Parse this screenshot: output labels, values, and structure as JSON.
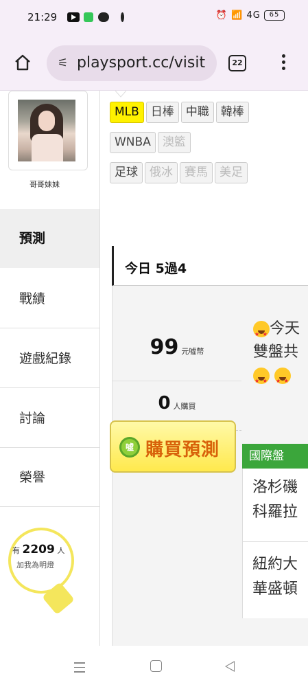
{
  "status_bar": {
    "time": "21:29",
    "network": "4G",
    "battery": "65"
  },
  "browser": {
    "url": "playsport.cc/visit",
    "tab_count": "22"
  },
  "sidebar": {
    "username": "哥哥妹妹",
    "items": [
      {
        "label": "預測",
        "active": true
      },
      {
        "label": "戰績"
      },
      {
        "label": "遊戲紀錄"
      },
      {
        "label": "討論"
      },
      {
        "label": "榮譽"
      }
    ],
    "light": {
      "prefix": "有",
      "count": "2209",
      "suffix": "人",
      "caption": "加我為明燈"
    }
  },
  "sports_tags": {
    "row1": [
      "MLB",
      "日棒",
      "中職",
      "韓棒"
    ],
    "row2": [
      "WNBA",
      "澳籃"
    ],
    "row3": [
      "足球",
      "俄冰",
      "賽馬",
      "美足"
    ]
  },
  "today": {
    "title": "今日 5過4"
  },
  "prediction": {
    "price": "99",
    "price_unit": "元噓幣",
    "buyers": "0",
    "buyers_unit": "人購買",
    "buy_label": "購買預測",
    "coin_label": "噓",
    "intro_line1": "今天",
    "intro_line2": "雙盤共"
  },
  "games": {
    "category": "國際盤",
    "list": [
      {
        "line1": "洛杉磯",
        "line2": "科羅拉"
      },
      {
        "line1": "紐約大",
        "line2": "華盛頓"
      }
    ]
  }
}
